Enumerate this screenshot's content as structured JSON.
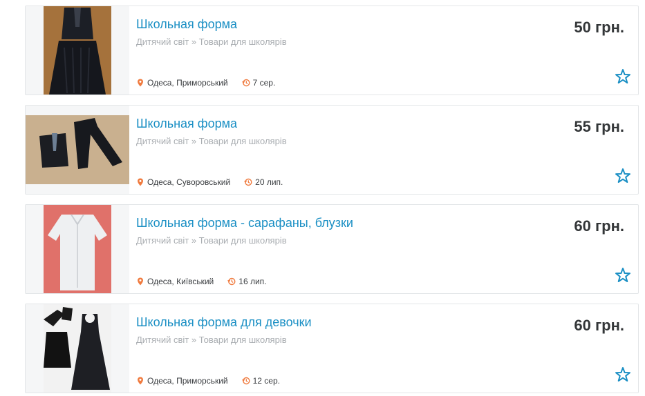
{
  "colors": {
    "title": "#1a8fc4",
    "category": "#a9adb1",
    "price": "#333638",
    "accent_orange": "#f07b3f",
    "star": "#1a8fc4"
  },
  "listings": [
    {
      "title": "Школьная форма",
      "category": "Дитячий світ » Товари для школярів",
      "location": "Одеса, Приморський",
      "date": "7 сер.",
      "price": "50 грн.",
      "image": "vest-and-skirt"
    },
    {
      "title": "Школьная форма",
      "category": "Дитячий світ » Товари для школярів",
      "location": "Одеса, Суворовський",
      "date": "20 лип.",
      "price": "55 грн.",
      "image": "vest-and-trousers"
    },
    {
      "title": "Школьная форма - сарафаны, блузки",
      "category": "Дитячий світ » Товари для школярів",
      "location": "Одеса, Київський",
      "date": "16 лип.",
      "price": "60 грн.",
      "image": "white-blouse"
    },
    {
      "title": "Школьная форма для девочки",
      "category": "Дитячий світ » Товари для школярів",
      "location": "Одеса, Приморський",
      "date": "12 сер.",
      "price": "60 грн.",
      "image": "girl-dress-set"
    }
  ]
}
